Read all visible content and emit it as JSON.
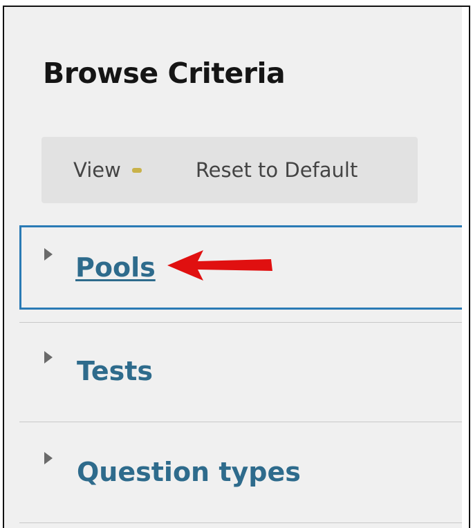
{
  "panel": {
    "title": "Browse Criteria"
  },
  "toolbar": {
    "view_label": "View",
    "reset_label": "Reset to Default"
  },
  "criteria": [
    {
      "label": "Pools",
      "selected": true,
      "expanded": false
    },
    {
      "label": "Tests",
      "selected": false,
      "expanded": false
    },
    {
      "label": "Question types",
      "selected": false,
      "expanded": false
    }
  ],
  "colors": {
    "link": "#2e6b8c",
    "selection_border": "#2a7ab5",
    "annotation_arrow": "#e01010"
  },
  "icons": {
    "expand": "caret-right-icon",
    "annotation": "red-arrow-icon"
  }
}
